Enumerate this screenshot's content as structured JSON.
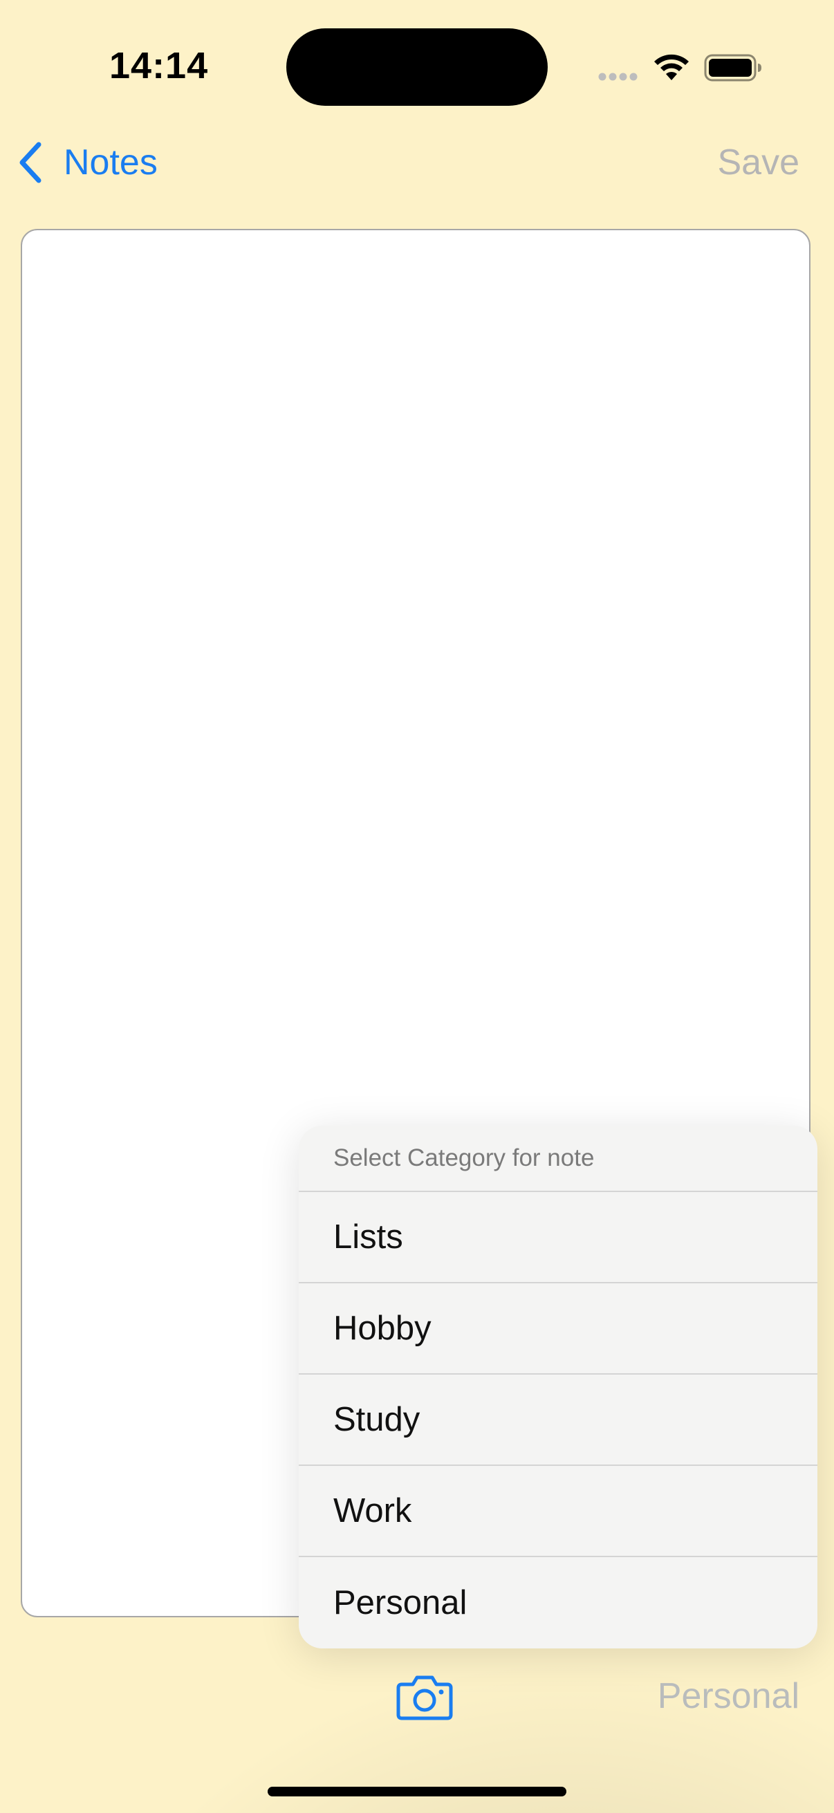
{
  "status_bar": {
    "time": "14:14",
    "icons": [
      "signal-dots-icon",
      "wifi-icon",
      "battery-icon"
    ]
  },
  "nav": {
    "back_label": "Notes",
    "save_label": "Save",
    "back_icon": "chevron-left-icon"
  },
  "editor": {
    "text": ""
  },
  "category_menu": {
    "title": "Select Category for note",
    "items": [
      {
        "label": "Lists"
      },
      {
        "label": "Hobby"
      },
      {
        "label": "Study"
      },
      {
        "label": "Work"
      },
      {
        "label": "Personal"
      }
    ]
  },
  "toolbar": {
    "camera_icon": "camera-icon",
    "category": "Personal"
  },
  "colors": {
    "background": "#fdf2c8",
    "accent": "#1a7df0",
    "disabled_text": "#b5b5b5",
    "menu_background": "#f4f4f3"
  }
}
